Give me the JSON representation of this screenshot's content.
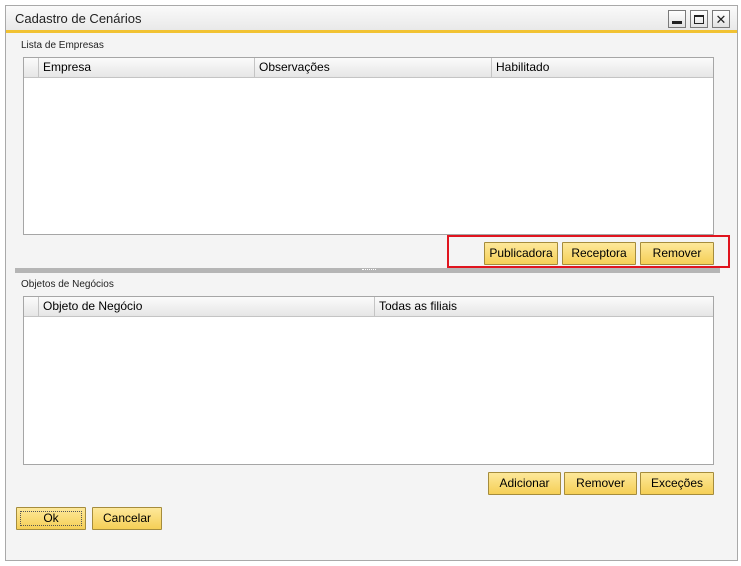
{
  "window": {
    "title": "Cadastro de Cenários",
    "controls": {
      "minimize": "minimize-icon",
      "maximize": "maximize-icon",
      "close": "close-icon"
    }
  },
  "empresas": {
    "label": "Lista de Empresas",
    "columns": [
      "Empresa",
      "Observações",
      "Habilitado"
    ],
    "rows": [],
    "buttons": {
      "publicadora": "Publicadora",
      "receptora": "Receptora",
      "remover": "Remover"
    }
  },
  "objetos": {
    "label": "Objetos de Negócios",
    "columns": [
      "Objeto de Negócio",
      "Todas as filiais"
    ],
    "rows": [],
    "buttons": {
      "adicionar": "Adicionar",
      "remover": "Remover",
      "excecoes": "Exceções"
    }
  },
  "footer": {
    "ok": "Ok",
    "cancelar": "Cancelar"
  },
  "colors": {
    "accent": "#f1c232",
    "button_bg": "#f5cf56",
    "highlight": "#e0141e"
  }
}
